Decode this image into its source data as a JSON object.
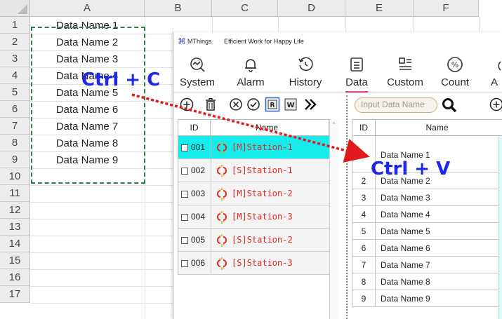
{
  "excel": {
    "columns": [
      "A",
      "B",
      "C",
      "D",
      "E",
      "F"
    ],
    "rows": [
      "1",
      "2",
      "3",
      "4",
      "5",
      "6",
      "7",
      "8",
      "9",
      "10",
      "11",
      "12",
      "13",
      "14",
      "15",
      "16",
      "17"
    ],
    "cells": [
      "Data Name 1",
      "Data Name 2",
      "Data Name 3",
      "Data Name 4",
      "Data Name 5",
      "Data Name 6",
      "Data Name 7",
      "Data Name 8",
      "Data Name 9"
    ]
  },
  "window": {
    "app_name": "MThings",
    "slogan": "Efficient Work for Happy Life",
    "ribbon": [
      {
        "label": "System",
        "icon": "system-icon"
      },
      {
        "label": "Alarm",
        "icon": "bell-icon"
      },
      {
        "label": "History",
        "icon": "history-icon"
      },
      {
        "label": "Data",
        "icon": "data-icon",
        "active": true
      },
      {
        "label": "Custom",
        "icon": "custom-icon"
      },
      {
        "label": "Count",
        "icon": "percent-icon"
      },
      {
        "label": "A",
        "icon": "clipped-icon"
      }
    ],
    "left_panel": {
      "header_id": "ID",
      "header_name": "Name",
      "rows": [
        {
          "id": "001",
          "name": "[M]Station-1",
          "selected": true
        },
        {
          "id": "002",
          "name": "[S]Station-1"
        },
        {
          "id": "003",
          "name": "[M]Station-2"
        },
        {
          "id": "004",
          "name": "[M]Station-3"
        },
        {
          "id": "005",
          "name": "[S]Station-2"
        },
        {
          "id": "006",
          "name": "[S]Station-3"
        }
      ]
    },
    "right_panel": {
      "search_placeholder": "Input Data Name",
      "header_id": "ID",
      "header_name": "Name",
      "rows": [
        {
          "id": "",
          "name": "Data Name 1"
        },
        {
          "id": "2",
          "name": "Data Name 2"
        },
        {
          "id": "3",
          "name": "Data Name 3"
        },
        {
          "id": "4",
          "name": "Data Name 4"
        },
        {
          "id": "5",
          "name": "Data Name 5"
        },
        {
          "id": "6",
          "name": "Data Name 6"
        },
        {
          "id": "7",
          "name": "Data Name 7"
        },
        {
          "id": "8",
          "name": "Data Name 8"
        },
        {
          "id": "9",
          "name": "Data Name 9"
        }
      ]
    }
  },
  "annotations": {
    "copy": "Ctrl + C",
    "paste": "Ctrl + V"
  },
  "colors": {
    "accent_blue": "#1d27e6",
    "arrow_red": "#e11b1b",
    "selection_cyan": "#17ecec",
    "station_red": "#e0271c",
    "marquee_green": "#2f7d4b"
  }
}
